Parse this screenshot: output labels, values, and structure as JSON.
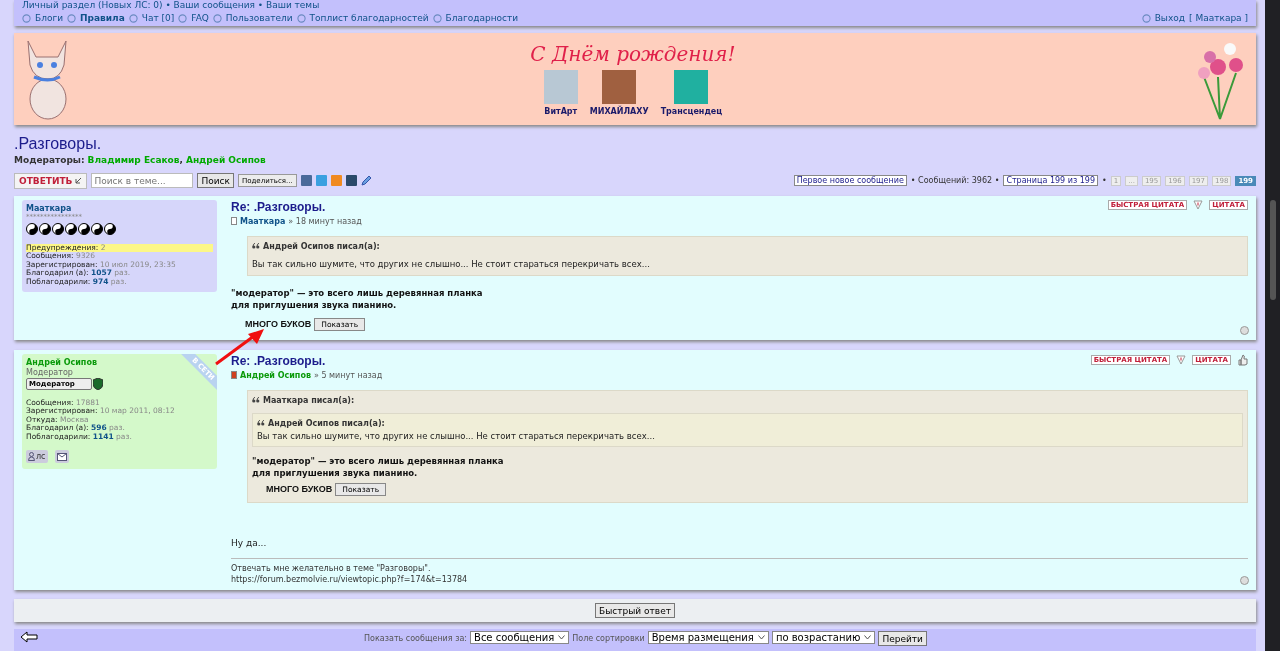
{
  "nav": {
    "top_line": "Личный раздел (Новых ЛС: 0) • Ваши сообщения • Ваши темы",
    "links": [
      {
        "label": "Блоги",
        "bold": false
      },
      {
        "label": "Правила",
        "bold": true
      },
      {
        "label": "Чат [0]",
        "bold": false
      },
      {
        "label": "FAQ",
        "bold": false
      },
      {
        "label": "Пользователи",
        "bold": false
      },
      {
        "label": "Топлист благодарностей",
        "bold": false
      },
      {
        "label": "Благодарности",
        "bold": false
      }
    ],
    "logout": {
      "label": "Выход",
      "user": "[ Мааткара ]"
    }
  },
  "banner": {
    "title": "С Днём рождения!",
    "users": [
      {
        "name": "ВитАрт"
      },
      {
        "name": "МИХАЙЛАХУ"
      },
      {
        "name": "Трансцендец"
      }
    ]
  },
  "forum": {
    "title": ".Разговоры.",
    "moderators_label": "Модераторы:",
    "moderators": [
      "Владимир Есаков",
      "Андрей Осипов"
    ],
    "separator": ","
  },
  "toolbar": {
    "reply": "ОТВЕТИТЬ",
    "search_placeholder": "Поиск в теме...",
    "search_button": "Поиск",
    "share": "Поделиться...",
    "first_new": "Первое новое сообщение",
    "count": "• Сообщений: 3962 •",
    "page": "Страница 199 из 199",
    "bullet": "•",
    "pages": [
      {
        "label": "1",
        "selected": false
      },
      {
        "label": "...",
        "selected": false
      },
      {
        "label": "195",
        "selected": false
      },
      {
        "label": "196",
        "selected": false
      },
      {
        "label": "197",
        "selected": false
      },
      {
        "label": "198",
        "selected": false
      },
      {
        "label": "199",
        "selected": true
      }
    ]
  },
  "posts": [
    {
      "kind": "user",
      "author": "Мааткара",
      "stars": "****************",
      "online": false,
      "stats": [
        {
          "label": "Предупреждения:",
          "value": "2",
          "strong": false,
          "highlight": true
        },
        {
          "label": "Сообщения:",
          "value": "9326",
          "strong": false,
          "highlight": false
        },
        {
          "label": "Зарегистрирован:",
          "value": "10 июл 2019, 23:35",
          "strong": false,
          "highlight": false
        },
        {
          "label": "Благодарил (а):",
          "value": "1057",
          "suffix": "раз.",
          "strong": true,
          "highlight": false
        },
        {
          "label": "Поблагодарили:",
          "value": "974",
          "suffix": "раз.",
          "strong": true,
          "highlight": false
        }
      ],
      "title": "Re: .Разговоры.",
      "meta_author": "Мааткара",
      "time": "» 18 минут назад",
      "actions": [
        {
          "kind": "quick_quote",
          "label": "БЫСТРАЯ ЦИТАТА"
        },
        {
          "kind": "report"
        },
        {
          "kind": "quote",
          "label": "ЦИТАТА"
        }
      ],
      "body": [
        {
          "kind": "quote",
          "author": "Андрей Осипов писал(а):",
          "body": [
            {
              "kind": "text",
              "text": "Вы так сильно шумите, что других не слышно... Не стоит стараться перекричать всех..."
            }
          ]
        },
        {
          "kind": "paragraph",
          "text": "\"модератор\" — это всего лишь деревянная планка для приглушения звука пианино."
        },
        {
          "kind": "spoiler",
          "label": "МНОГО БУКОВ",
          "button": "Показать"
        }
      ]
    },
    {
      "kind": "moderator",
      "author": "Андрей Осипов",
      "rank": "Модератор",
      "badge": "Модератор",
      "online": true,
      "online_label": "В СЕТИ",
      "stats": [
        {
          "label": "Сообщения:",
          "value": "17881",
          "strong": false,
          "highlight": false
        },
        {
          "label": "Зарегистрирован:",
          "value": "10 мар 2011, 08:12",
          "strong": false,
          "highlight": false
        },
        {
          "label": "Откуда:",
          "value": "Москва",
          "strong": false,
          "highlight": false
        },
        {
          "label": "Благодарил (а):",
          "value": "596",
          "suffix": "раз.",
          "strong": true,
          "highlight": false
        },
        {
          "label": "Поблагодарили:",
          "value": "1141",
          "suffix": "раз.",
          "strong": true,
          "highlight": false
        }
      ],
      "contacts": [
        {
          "kind": "pm",
          "label": "лс"
        },
        {
          "kind": "email"
        }
      ],
      "title": "Re: .Разговоры.",
      "meta_author": "Андрей Осипов",
      "time": "» 5 минут назад",
      "actions": [
        {
          "kind": "quick_quote",
          "label": "БЫСТРАЯ ЦИТАТА"
        },
        {
          "kind": "report"
        },
        {
          "kind": "quote",
          "label": "ЦИТАТА"
        },
        {
          "kind": "thanks"
        }
      ],
      "body": [
        {
          "kind": "quote",
          "author": "Мааткара писал(а):",
          "body": [
            {
              "kind": "quote",
              "author": "Андрей Осипов писал(а):",
              "body": [
                {
                  "kind": "text",
                  "text": "Вы так сильно шумите, что других не слышно... Не стоит стараться перекричать всех..."
                }
              ]
            },
            {
              "kind": "paragraph",
              "text": "\"модератор\" — это всего лишь деревянная планка для приглушения звука пианино."
            },
            {
              "kind": "spoiler",
              "label": "МНОГО БУКОВ",
              "button": "Показать"
            }
          ]
        },
        {
          "kind": "text",
          "text": "Ну да..."
        }
      ],
      "signature": [
        "Отвечать мне желательно в теме \"Разговоры\".",
        "https://forum.bezmolvie.ru/viewtopic.php?f=174&t=13784"
      ]
    }
  ],
  "quick_reply": "Быстрый ответ",
  "footer": {
    "show_label": "Показать сообщения за:",
    "show_value": "Все сообщения",
    "sort_label": "Поле сортировки",
    "sort_value": "Время размещения",
    "order_value": "по возрастанию",
    "go": "Перейти"
  }
}
